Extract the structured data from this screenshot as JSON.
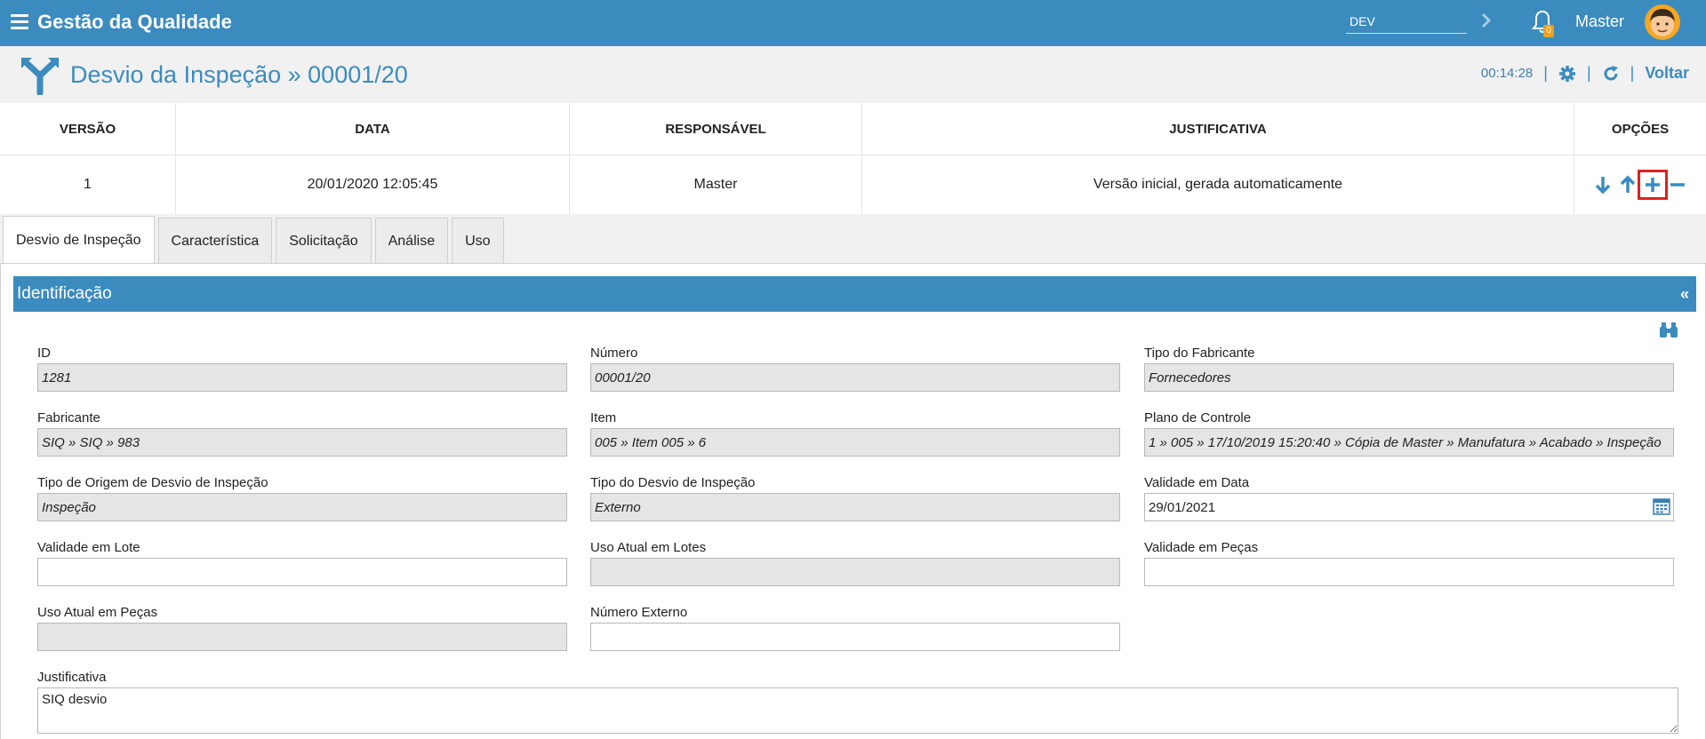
{
  "app": {
    "title": "Gestão da Qualidade"
  },
  "topbar": {
    "environment": "DEV",
    "notifications_count": "0",
    "user_name": "Master"
  },
  "header": {
    "title": "Desvio da Inspeção » 00001/20",
    "time": "00:14:28",
    "back_label": "Voltar"
  },
  "versions": {
    "headers": [
      "VERSÃO",
      "DATA",
      "RESPONSÁVEL",
      "JUSTIFICATIVA",
      "OPÇÕES"
    ],
    "rows": [
      {
        "version": "1",
        "date": "20/01/2020 12:05:45",
        "responsible": "Master",
        "justification": "Versão inicial, gerada automaticamente"
      }
    ]
  },
  "tabs": [
    "Desvio de Inspeção",
    "Característica",
    "Solicitação",
    "Análise",
    "Uso"
  ],
  "section": {
    "title": "Identificação",
    "collapse_label": "«"
  },
  "fields": {
    "id": {
      "label": "ID",
      "value": "1281"
    },
    "numero": {
      "label": "Número",
      "value": "00001/20"
    },
    "tipo_fabricante": {
      "label": "Tipo do Fabricante",
      "value": "Fornecedores"
    },
    "fabricante": {
      "label": "Fabricante",
      "value": "SIQ » SIQ » 983"
    },
    "item": {
      "label": "Item",
      "value": "005 » Item 005 » 6"
    },
    "plano_controle": {
      "label": "Plano de Controle",
      "value": "1 » 005 » 17/10/2019 15:20:40 » Cópia de Master » Manufatura » Acabado » Inspeção"
    },
    "tipo_origem": {
      "label": "Tipo de Origem de Desvio de Inspeção",
      "value": "Inspeção"
    },
    "tipo_desvio": {
      "label": "Tipo do Desvio de Inspeção",
      "value": "Externo"
    },
    "validade_data": {
      "label": "Validade em Data",
      "value": "29/01/2021"
    },
    "validade_lote": {
      "label": "Validade em Lote",
      "value": ""
    },
    "uso_atual_lotes": {
      "label": "Uso Atual em Lotes",
      "value": ""
    },
    "validade_pecas": {
      "label": "Validade em Peças",
      "value": ""
    },
    "uso_atual_pecas": {
      "label": "Uso Atual em Peças",
      "value": ""
    },
    "numero_externo": {
      "label": "Número Externo",
      "value": ""
    },
    "justificativa": {
      "label": "Justificativa",
      "value": "SIQ desvio"
    }
  },
  "colors": {
    "primary": "#3b8bbf",
    "highlight": "#e02020"
  }
}
